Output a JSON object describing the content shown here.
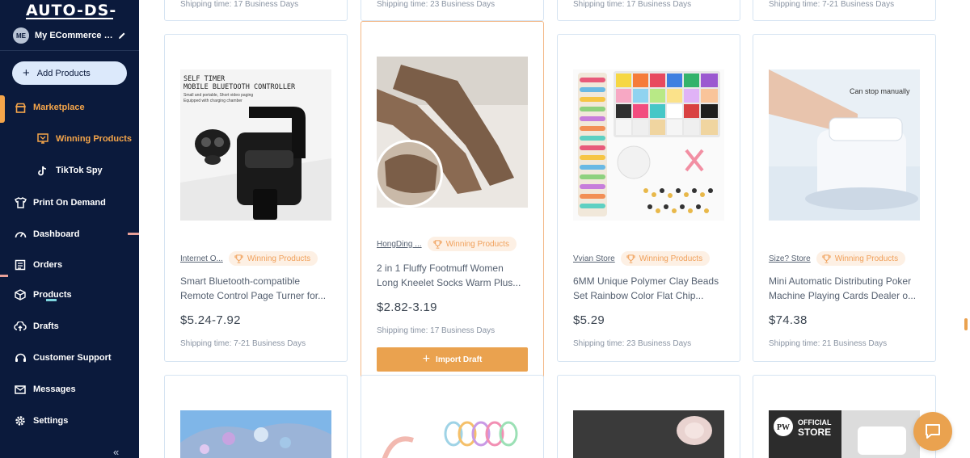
{
  "sidebar": {
    "logo": "AUTO-DS-",
    "store": {
      "initials": "ME",
      "name": "My ECommerce St..."
    },
    "add_products": "Add Products",
    "items": [
      {
        "label": "Marketplace",
        "icon": "store-icon"
      },
      {
        "label": "Winning Products",
        "icon": "trophy-icon"
      },
      {
        "label": "TikTok Spy",
        "icon": "tiktok-icon"
      },
      {
        "label": "Print On Demand",
        "icon": "shirt-icon"
      },
      {
        "label": "Dashboard",
        "icon": "gauge-icon"
      },
      {
        "label": "Orders",
        "icon": "orders-icon"
      },
      {
        "label": "Products",
        "icon": "box-icon"
      },
      {
        "label": "Drafts",
        "icon": "cloud-upload-icon"
      },
      {
        "label": "Customer Support",
        "icon": "headset-icon"
      },
      {
        "label": "Messages",
        "icon": "mail-icon"
      },
      {
        "label": "Settings",
        "icon": "gear-icon"
      }
    ],
    "collapse_glyph": "«"
  },
  "top_row": [
    {
      "shipping": "Shipping time: 17 Business Days"
    },
    {
      "shipping": "Shipping time: 23 Business Days"
    },
    {
      "shipping": "Shipping time: 17 Business Days"
    },
    {
      "shipping": "Shipping time: 7-21 Business Days"
    }
  ],
  "cards": [
    {
      "store": "Internet O...",
      "badge": "Winning Products",
      "title_line1": "Smart Bluetooth-compatible",
      "title_line2": "Remote Control Page Turner for...",
      "price": "$5.24-7.92",
      "shipping": "Shipping time: 7-21 Business Days",
      "image_text1": "SELF TIMER",
      "image_text2": "MOBILE BLUETOOTH CONTROLLER",
      "image_text3": "Small and portable, Short video paging",
      "image_text4": "Equipped with charging chamber"
    },
    {
      "store": "HongDing ...",
      "badge": "Winning Products",
      "title_line1": "2 in 1 Fluffy Footmuff Women",
      "title_line2": "Long Kneelet Socks Warm Plus...",
      "price": "$2.82-3.19",
      "shipping": "Shipping time: 17 Business Days",
      "button": "Import Draft"
    },
    {
      "store": "Vvian Store",
      "badge": "Winning Products",
      "title_line1": "6MM Unique Polymer Clay Beads",
      "title_line2": "Set Rainbow Color Flat Chip...",
      "price": "$5.29",
      "shipping": "Shipping time: 23 Business Days"
    },
    {
      "store": "Size? Store",
      "badge": "Winning Products",
      "title_line1": "Mini Automatic Distributing Poker",
      "title_line2": "Machine Playing Cards Dealer o...",
      "price": "$74.38",
      "shipping": "Shipping time: 21 Business Days",
      "image_text1": "Can stop manually"
    }
  ],
  "bottom_row": [
    {
      "image_text1": ""
    },
    {
      "image_text1": ""
    },
    {
      "image_text1": ""
    },
    {
      "image_text1": "OFFICIAL",
      "image_text2": "STORE",
      "image_text3": "PW"
    }
  ],
  "colors": {
    "sidebar_bg": "#0b1a3c",
    "accent": "#eaa24f",
    "card_border": "#d6e4f2"
  }
}
